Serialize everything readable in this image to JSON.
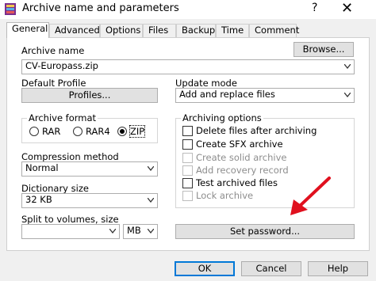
{
  "window": {
    "title": "Archive name and parameters",
    "help_glyph": "?",
    "close_glyph": "✕"
  },
  "tabs": [
    {
      "label": "General"
    },
    {
      "label": "Advanced"
    },
    {
      "label": "Options"
    },
    {
      "label": "Files"
    },
    {
      "label": "Backup"
    },
    {
      "label": "Time"
    },
    {
      "label": "Comment"
    }
  ],
  "archive_name": {
    "label": "Archive name",
    "value": "CV-Europass.zip",
    "browse_label": "Browse..."
  },
  "default_profile": {
    "label": "Default Profile",
    "button": "Profiles..."
  },
  "update_mode": {
    "label": "Update mode",
    "value": "Add and replace files"
  },
  "archive_format": {
    "title": "Archive format",
    "options": [
      {
        "label": "RAR"
      },
      {
        "label": "RAR4"
      },
      {
        "label": "ZIP"
      }
    ],
    "selected": "ZIP"
  },
  "compression_method": {
    "label": "Compression method",
    "value": "Normal"
  },
  "dictionary_size": {
    "label": "Dictionary size",
    "value": "32 KB"
  },
  "split_volumes": {
    "label": "Split to volumes, size",
    "value": "",
    "unit": "MB"
  },
  "archiving_options": {
    "title": "Archiving options",
    "items": [
      {
        "label": "Delete files after archiving",
        "checked": false,
        "enabled": true
      },
      {
        "label": "Create SFX archive",
        "checked": false,
        "enabled": true
      },
      {
        "label": "Create solid archive",
        "checked": false,
        "enabled": false
      },
      {
        "label": "Add recovery record",
        "checked": false,
        "enabled": false
      },
      {
        "label": "Test archived files",
        "checked": false,
        "enabled": true
      },
      {
        "label": "Lock archive",
        "checked": false,
        "enabled": false
      }
    ]
  },
  "set_password": {
    "label": "Set password..."
  },
  "footer": {
    "ok": "OK",
    "cancel": "Cancel",
    "help": "Help"
  },
  "colors": {
    "annotation_arrow": "#e0101e",
    "focus_border": "#0078d7"
  }
}
